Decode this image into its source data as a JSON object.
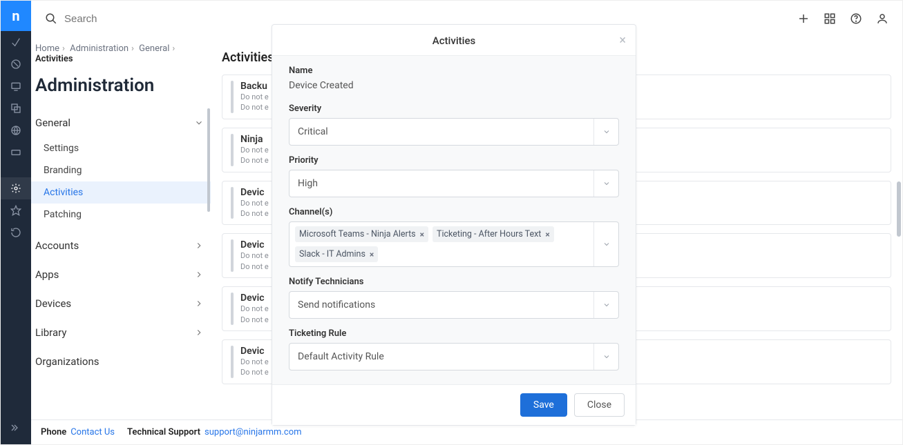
{
  "search_placeholder": "Search",
  "breadcrumb": [
    "Home",
    "Administration",
    "General",
    "Activities"
  ],
  "page_title": "Administration",
  "sidebar": {
    "general": {
      "label": "General",
      "items": [
        "Settings",
        "Branding",
        "Activities",
        "Patching"
      ],
      "active_index": 2
    },
    "sections": [
      "Accounts",
      "Apps",
      "Devices",
      "Library",
      "Organizations"
    ]
  },
  "content_title": "Activities",
  "activities": [
    {
      "title": "Backu",
      "sub1": "Do not e",
      "sub2": "Do not e"
    },
    {
      "title": "Ninja",
      "sub1": "Do not e",
      "sub2": "Do not e"
    },
    {
      "title": "Devic",
      "sub1": "Do not e",
      "sub2": "Do not e"
    },
    {
      "title": "Devic",
      "sub1": "Do not e",
      "sub2": "Do not e"
    },
    {
      "title": "Devic",
      "sub1": "Do not e",
      "sub2": "Do not e"
    },
    {
      "title": "Devic",
      "sub1": "Do not e",
      "sub2": "Do not e"
    }
  ],
  "footer": {
    "phone_label": "Phone",
    "contact_us": "Contact Us",
    "tech_label": "Technical Support",
    "tech_email": "support@ninjarmm.com"
  },
  "modal": {
    "title": "Activities",
    "name_label": "Name",
    "name_value": "Device Created",
    "severity_label": "Severity",
    "severity_value": "Critical",
    "priority_label": "Priority",
    "priority_value": "High",
    "channels_label": "Channel(s)",
    "channels": [
      "Microsoft Teams - Ninja Alerts",
      "Ticketing - After Hours Text",
      "Slack - IT Admins"
    ],
    "notify_label": "Notify Technicians",
    "notify_value": "Send notifications",
    "ticketing_label": "Ticketing Rule",
    "ticketing_value": "Default Activity Rule",
    "save": "Save",
    "close": "Close"
  }
}
